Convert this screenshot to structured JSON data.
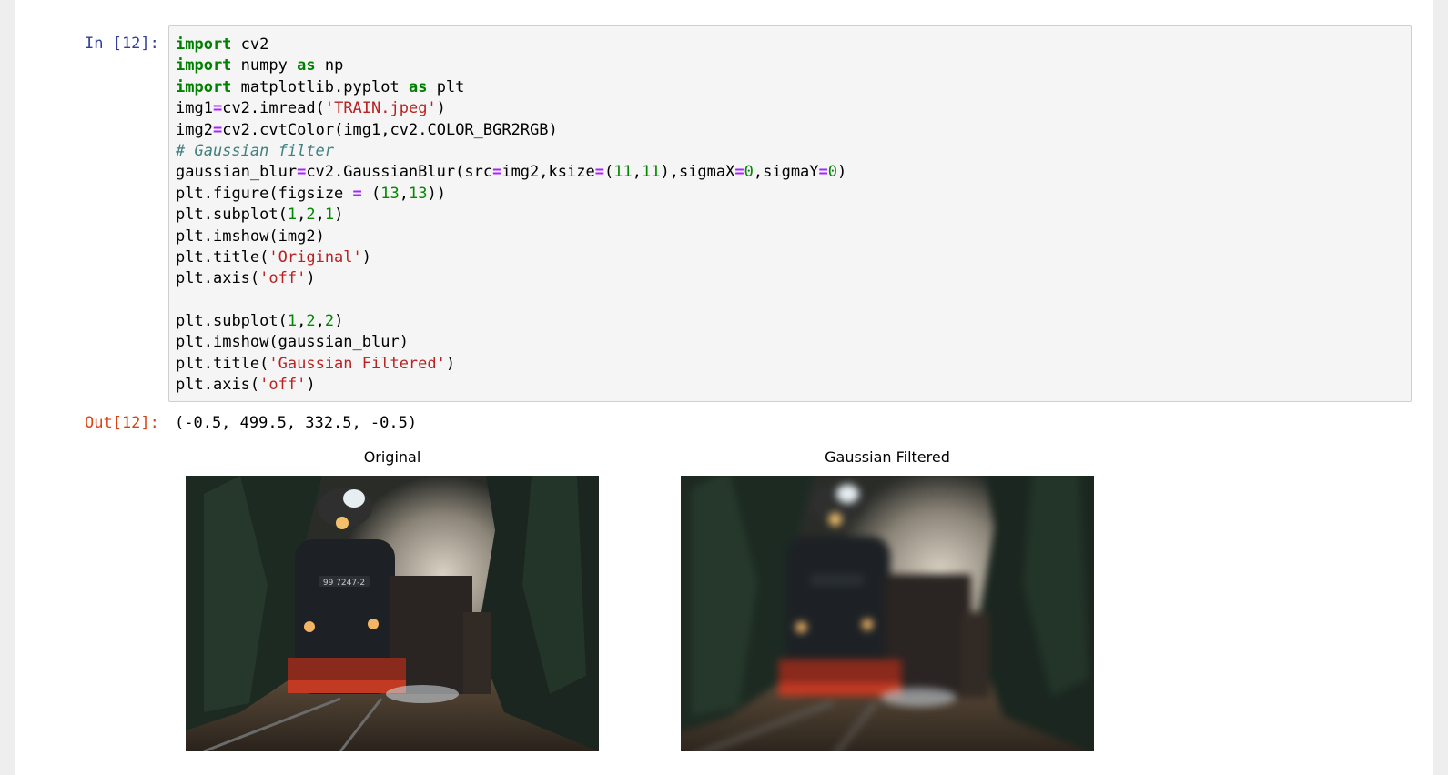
{
  "cell": {
    "in_prompt": "In [12]:",
    "out_prompt": "Out[12]:",
    "output_text": "(-0.5, 499.5, 332.5, -0.5)"
  },
  "code_lines": [
    "import cv2",
    "import numpy as np",
    "import matplotlib.pyplot as plt",
    "img1=cv2.imread('TRAIN.jpeg')",
    "img2=cv2.cvtColor(img1,cv2.COLOR_BGR2RGB)",
    "# Gaussian filter",
    "gaussian_blur=cv2.GaussianBlur(src=img2,ksize=(11,11),sigmaX=0,sigmaY=0)",
    "plt.figure(figsize = (13,13))",
    "plt.subplot(1,2,1)",
    "plt.imshow(img2)",
    "plt.title('Original')",
    "plt.axis('off')",
    "",
    "plt.subplot(1,2,2)",
    "plt.imshow(gaussian_blur)",
    "plt.title('Gaussian Filtered')",
    "plt.axis('off')"
  ],
  "figure": {
    "left_title": "Original",
    "right_title": "Gaussian Filtered",
    "locomotive_number": "99 7247-2"
  },
  "colors": {
    "in_prompt": "#303f9f",
    "out_prompt": "#d84315",
    "keyword": "#008000",
    "operator": "#aa22ff",
    "string": "#ba2121",
    "number": "#008800",
    "comment": "#408080"
  }
}
